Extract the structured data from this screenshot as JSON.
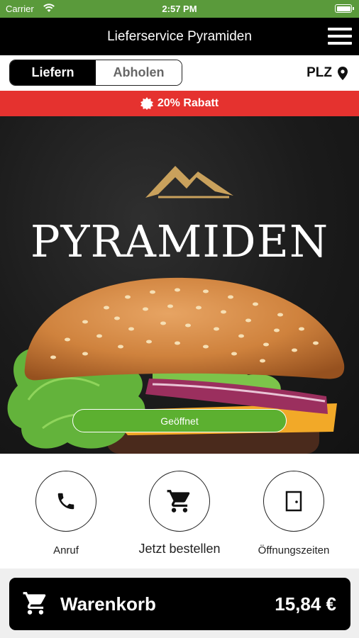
{
  "status_bar": {
    "carrier": "Carrier",
    "time": "2:57 PM"
  },
  "header": {
    "title": "Lieferservice Pyramiden"
  },
  "mode_toggle": {
    "deliver": "Liefern",
    "pickup": "Abholen"
  },
  "plz": {
    "label": "PLZ"
  },
  "banner": {
    "text": "20% Rabatt"
  },
  "hero": {
    "brand": "PYRAMIDEN",
    "status_button": "Geöffnet"
  },
  "actions": [
    {
      "label": "Anruf",
      "icon": "phone-icon"
    },
    {
      "label": "Jetzt bestellen",
      "icon": "cart-icon"
    },
    {
      "label": "Öffnungszeiten",
      "icon": "door-icon"
    }
  ],
  "cart": {
    "label": "Warenkorb",
    "price": "15,84 €"
  },
  "colors": {
    "status_green": "#5a9a3b",
    "banner_red": "#e5322f",
    "open_green": "#5cb030",
    "gold": "#c9a15c"
  }
}
